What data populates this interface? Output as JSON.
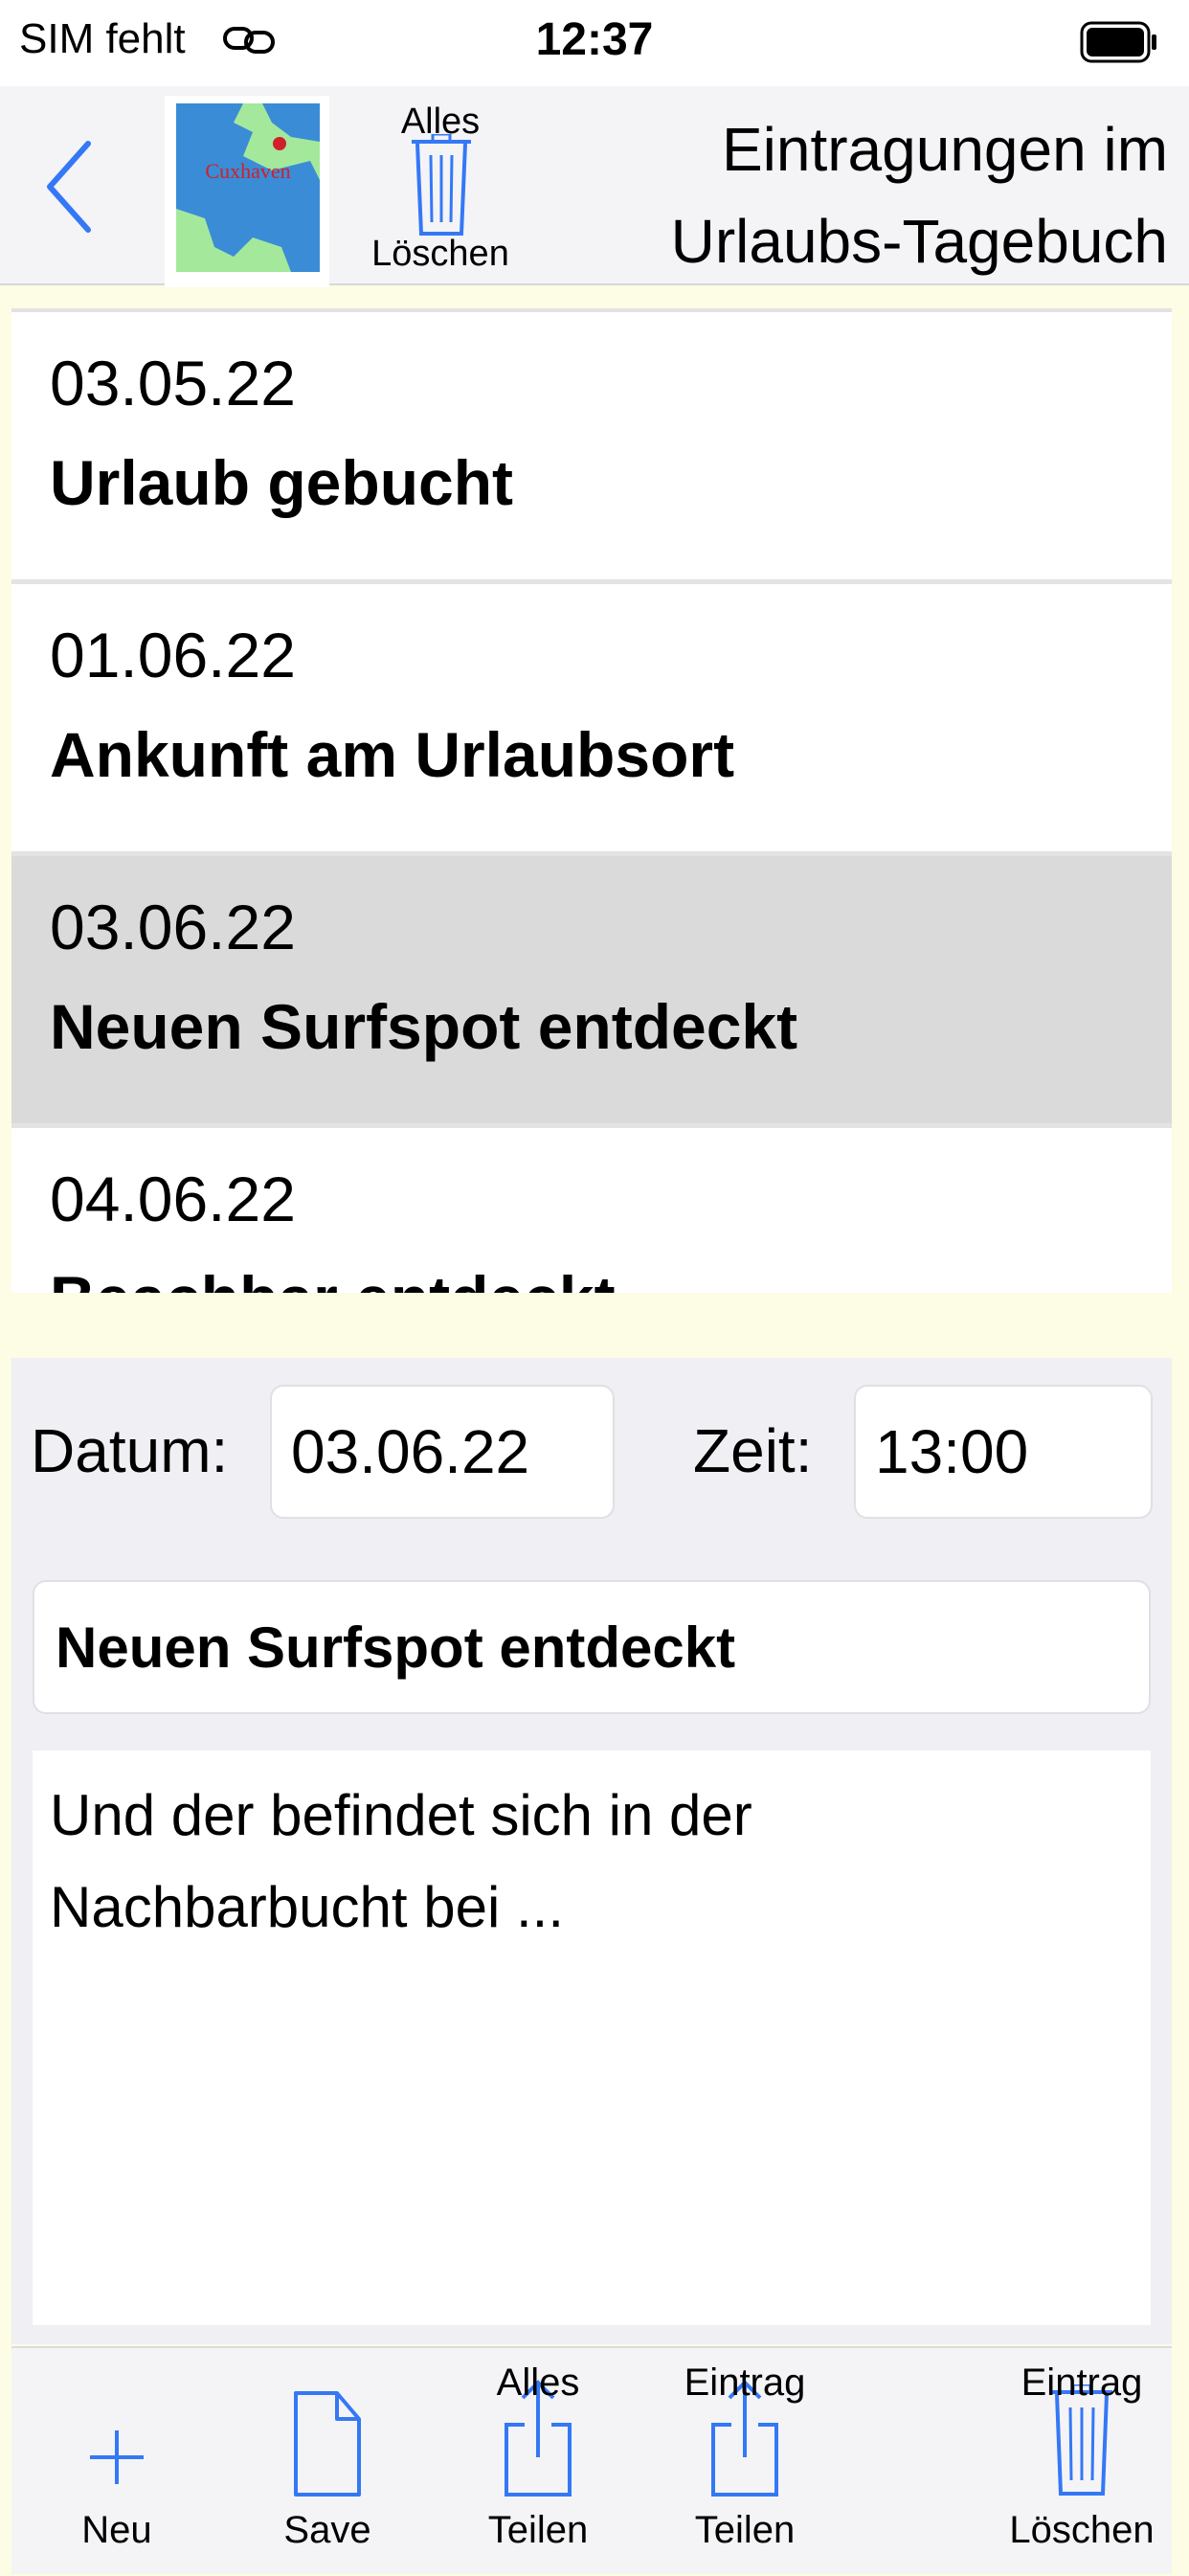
{
  "status_bar": {
    "carrier": "SIM fehlt",
    "link_icon": "link-icon",
    "time": "12:37",
    "battery_icon": "battery-icon"
  },
  "header": {
    "back_icon": "chevron-left-icon",
    "map_label": "Cuxhaven",
    "clear_all": {
      "top": "Alles",
      "bottom": "Löschen",
      "icon": "trash-icon"
    },
    "title_line1": "Eintragungen im",
    "title_line2": "Urlaubs-Tagebuch"
  },
  "colors": {
    "accent": "#3478f6",
    "selected_row": "#dadada",
    "map_land": "#a4e89c",
    "map_water": "#3a8cd6",
    "map_marker": "#d0202a"
  },
  "entries": [
    {
      "date": "03.05.22",
      "title": "Urlaub gebucht",
      "selected": false
    },
    {
      "date": "01.06.22",
      "title": "Ankunft am Urlaubsort",
      "selected": false
    },
    {
      "date": "03.06.22",
      "title": "Neuen Surfspot entdeckt",
      "selected": true
    },
    {
      "date": "04.06.22",
      "title": "Beachbar entdeckt",
      "selected": false
    }
  ],
  "editor": {
    "date_label": "Datum:",
    "date_value": "03.06.22",
    "time_label": "Zeit:",
    "time_value": "13:00",
    "title_value": "Neuen Surfspot entdeckt",
    "body_value": "Und der befindet sich in der\nNachbarbucht bei ..."
  },
  "toolbar": {
    "new": {
      "label": "Neu",
      "icon": "plus-icon"
    },
    "save": {
      "label": "Save",
      "icon": "document-icon"
    },
    "share_all": {
      "top": "Alles",
      "bottom": "Teilen",
      "icon": "share-icon"
    },
    "share_entry": {
      "top": "Eintrag",
      "bottom": "Teilen",
      "icon": "share-icon"
    },
    "delete_entry": {
      "top": "Eintrag",
      "bottom": "Löschen",
      "icon": "trash-icon"
    }
  }
}
